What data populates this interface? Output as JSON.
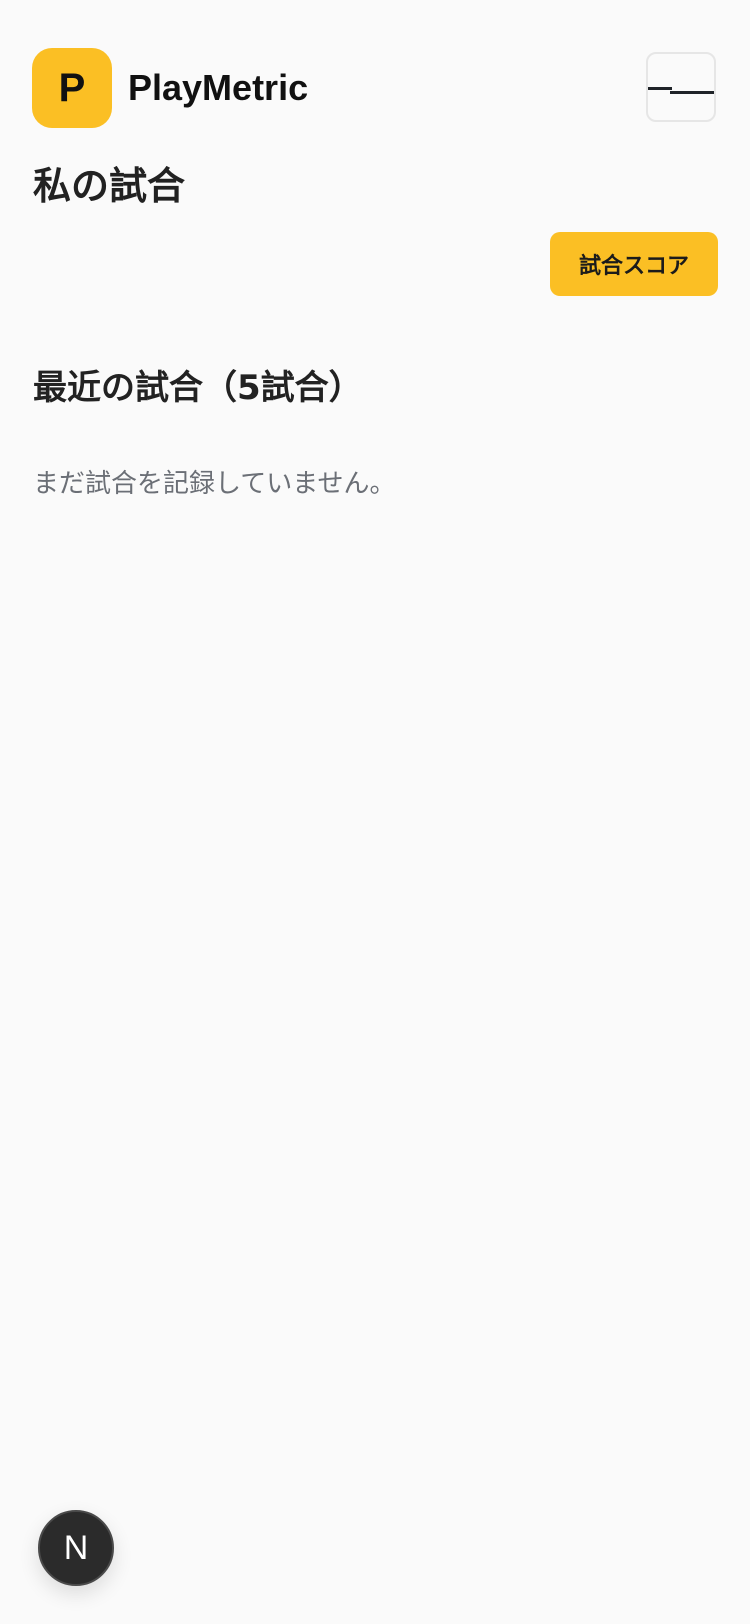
{
  "header": {
    "logo_letter": "P",
    "brand_name": "PlayMetric",
    "menu_icon": "hamburger-menu-icon"
  },
  "main": {
    "page_title": "私の試合",
    "score_button_label": "試合スコア",
    "recent_section_title": "最近の試合（5試合）",
    "empty_message": "まだ試合を記録していません。"
  },
  "badge": {
    "letter": "N"
  },
  "colors": {
    "accent": "#fbbf24",
    "background": "#fafafa",
    "text": "#222222",
    "muted_text": "#6b6f76",
    "badge_bg": "#2b2b2b"
  }
}
